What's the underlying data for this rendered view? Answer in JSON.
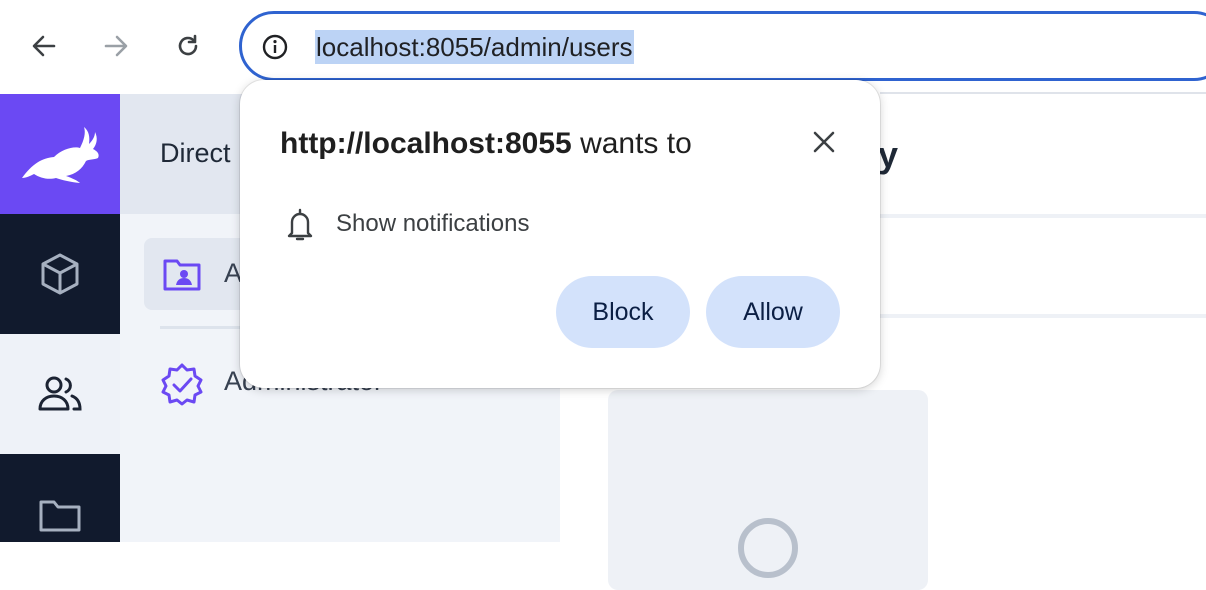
{
  "browser": {
    "url": "localhost:8055/admin/users",
    "nav": {
      "back_icon": "back-arrow-icon",
      "forward_icon": "forward-arrow-icon",
      "reload_icon": "reload-icon"
    }
  },
  "app": {
    "rail": [
      "logo-icon",
      "box-icon",
      "users-icon",
      "folder-icon"
    ],
    "panel": {
      "title": "Direct",
      "items": [
        {
          "label": "A",
          "icon": "folder-user-icon"
        },
        {
          "label": "Administrator",
          "icon": "verified-badge-icon"
        }
      ]
    },
    "main": {
      "title": "ctory"
    }
  },
  "popup": {
    "origin": "http://localhost:8055",
    "title_suffix": "wants to",
    "permission": "Show notifications",
    "block_label": "Block",
    "allow_label": "Allow"
  },
  "colors": {
    "accent": "#6b49f3",
    "rail": "#111a2d",
    "omnibox_focus": "#2f63d0",
    "url_highlight": "#bcd3f5",
    "popup_button": "#d3e2fb"
  }
}
